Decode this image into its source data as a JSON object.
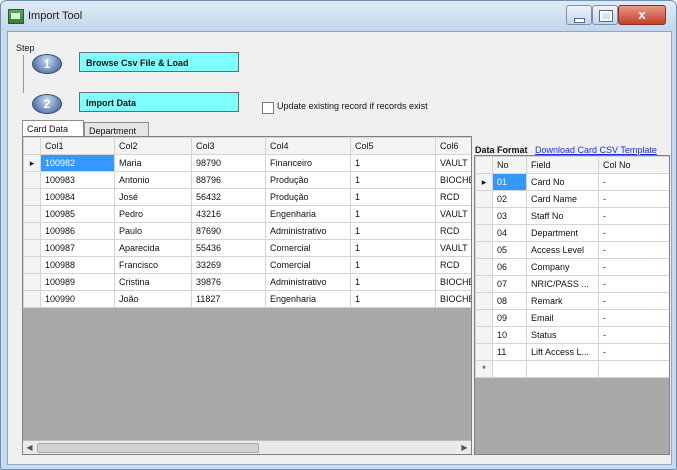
{
  "window": {
    "title": "Import Tool",
    "close_glyph": "x"
  },
  "step": {
    "label": "Step",
    "step1_number": "1",
    "step1_button": "Browse Csv File & Load",
    "step2_number": "2",
    "step2_button": "Import Data",
    "update_checkbox_label": "Update existing record if records exist",
    "update_checked": false
  },
  "tabs": [
    {
      "label": "Card Data",
      "active": true
    },
    {
      "label": "Department",
      "active": false
    }
  ],
  "grid": {
    "columns": [
      "Col1",
      "Col2",
      "Col3",
      "Col4",
      "Col5",
      "Col6"
    ],
    "rows": [
      [
        "100982",
        "Maria",
        "98790",
        "Financeiro",
        "1",
        "VAULT"
      ],
      [
        "100983",
        "Antonio",
        "88796",
        "Produção",
        "1",
        "BIOCHEM"
      ],
      [
        "100984",
        "José",
        "56432",
        "Produção",
        "1",
        "RCD"
      ],
      [
        "100985",
        "Pedro",
        "43216",
        "Engenharia",
        "1",
        "VAULT"
      ],
      [
        "100986",
        "Paulo",
        "87690",
        "Administrativo",
        "1",
        "RCD"
      ],
      [
        "100987",
        "Aparecida",
        "55436",
        "Comercial",
        "1",
        "VAULT"
      ],
      [
        "100988",
        "Francisco",
        "33269",
        "Comercial",
        "1",
        "RCD"
      ],
      [
        "100989",
        "Cristina",
        "39876",
        "Administrativo",
        "1",
        "BIOCHEM"
      ],
      [
        "100990",
        "João",
        "11827",
        "Engenharia",
        "1",
        "BIOCHEM"
      ]
    ],
    "current_row_marker": "▸",
    "scroll_left": "◀",
    "scroll_right": "▶",
    "scroll_grip": "|||"
  },
  "data_format": {
    "title": "Data Format",
    "link_text": "Download Card CSV Template",
    "columns": [
      "No",
      "Field",
      "Col No"
    ],
    "rows": [
      [
        "01",
        "Card No",
        "-"
      ],
      [
        "02",
        "Card Name",
        "-"
      ],
      [
        "03",
        "Staff No",
        "-"
      ],
      [
        "04",
        "Department",
        "-"
      ],
      [
        "05",
        "Access Level",
        "-"
      ],
      [
        "06",
        "Company",
        "-"
      ],
      [
        "07",
        "NRIC/PASS ...",
        "-"
      ],
      [
        "08",
        "Remark",
        "-"
      ],
      [
        "09",
        "Email",
        "-"
      ],
      [
        "10",
        "Status",
        "-"
      ],
      [
        "11",
        "Lift Access L...",
        "-"
      ]
    ],
    "current_row_marker": "▸",
    "new_row_marker": "*"
  },
  "colors": {
    "button_fill": "#80ffff",
    "selection": "#3399ff",
    "link": "#1a2be0",
    "close_button": "#c4402a"
  },
  "icons": [
    "app-icon",
    "minimize-icon",
    "maximize-icon",
    "close-icon",
    "checkbox-icon"
  ]
}
